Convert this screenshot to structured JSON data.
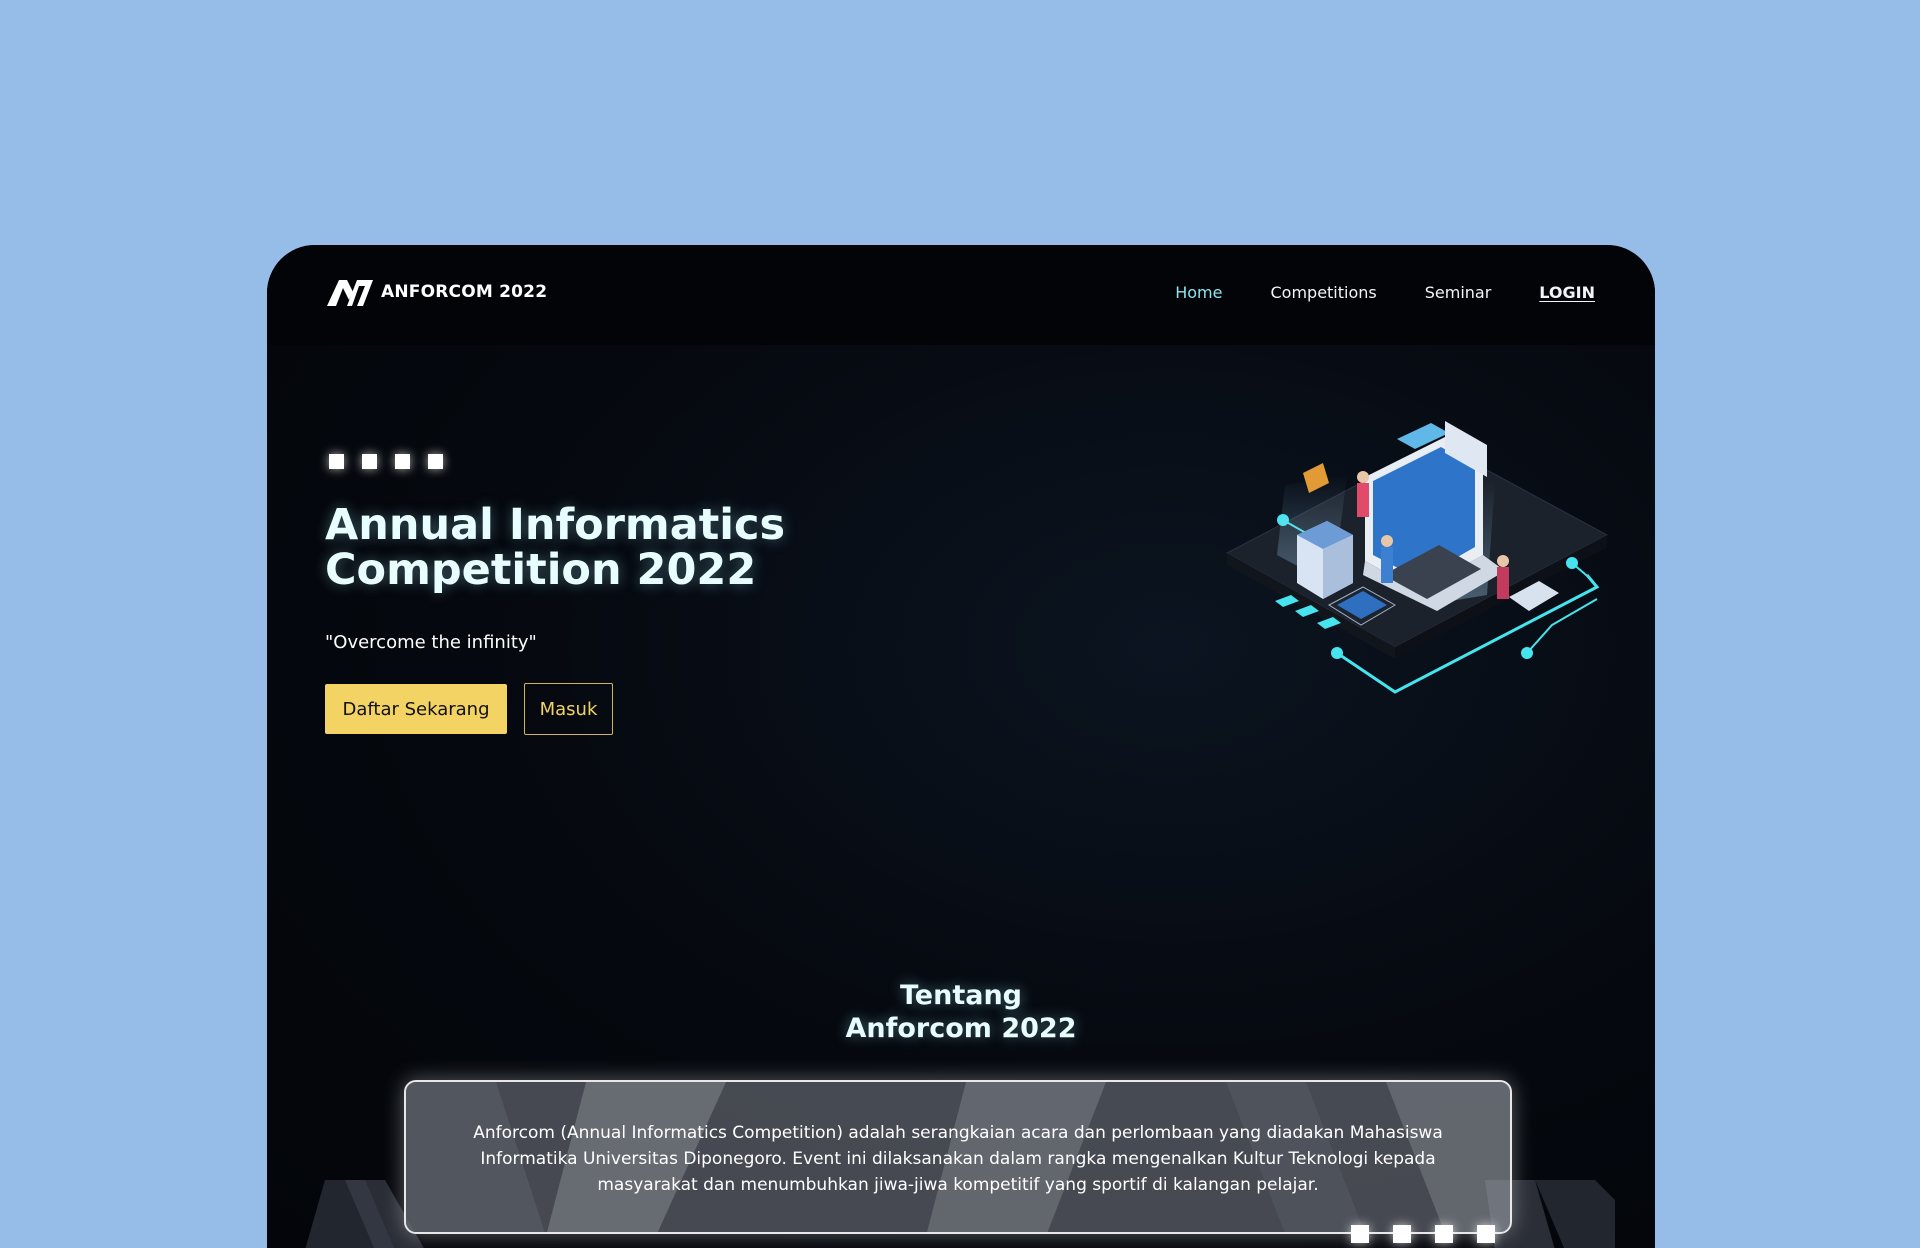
{
  "brand": {
    "name": "ANFORCOM 2022"
  },
  "nav": {
    "home": "Home",
    "competitions": "Competitions",
    "seminar": "Seminar",
    "login": "LOGIN"
  },
  "hero": {
    "title_line1": "Annual Informatics",
    "title_line2": "Competition 2022",
    "tagline": "\"Overcome the infinity\"",
    "primary_button": "Daftar Sekarang",
    "secondary_button": "Masuk"
  },
  "about": {
    "title_line1": "Tentang",
    "title_line2": "Anforcom 2022",
    "body": "Anforcom (Annual Informatics Competition) adalah serangkaian acara dan perlombaan yang diadakan Mahasiswa Informatika Universitas Diponegoro. Event ini dilaksanakan dalam rangka mengenalkan Kultur Teknologi kepada masyarakat dan menumbuhkan jiwa-jiwa kompetitif yang sportif di kalangan pelajar."
  },
  "colors": {
    "page_background": "#95bde8",
    "frame_background": "#05080e",
    "accent_yellow": "#f3d363",
    "accent_cyan": "#8ee3ef",
    "text_white": "#ffffff"
  }
}
